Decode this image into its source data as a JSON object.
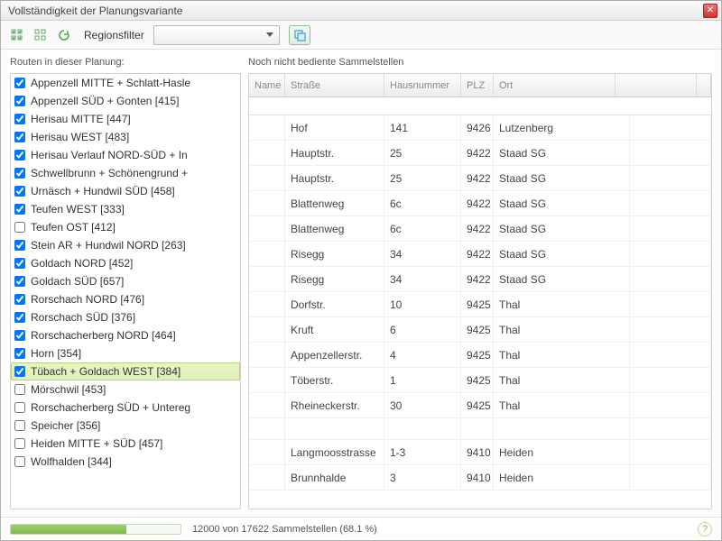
{
  "window": {
    "title": "Vollständigkeit der Planungsvariante"
  },
  "toolbar": {
    "filter_label": "Regionsfilter",
    "filter_value": ""
  },
  "left": {
    "label": "Routen in dieser Planung:",
    "routes": [
      {
        "label": "Appenzell MITTE + Schlatt-Hasle",
        "checked": true,
        "selected": false
      },
      {
        "label": "Appenzell SÜD + Gonten [415]",
        "checked": true,
        "selected": false
      },
      {
        "label": "Herisau MITTE [447]",
        "checked": true,
        "selected": false
      },
      {
        "label": "Herisau WEST [483]",
        "checked": true,
        "selected": false
      },
      {
        "label": "Herisau Verlauf NORD-SÜD + In",
        "checked": true,
        "selected": false
      },
      {
        "label": "Schwellbrunn + Schönengrund +",
        "checked": true,
        "selected": false
      },
      {
        "label": "Urnäsch + Hundwil SÜD [458]",
        "checked": true,
        "selected": false
      },
      {
        "label": "Teufen WEST [333]",
        "checked": true,
        "selected": false
      },
      {
        "label": "Teufen OST [412]",
        "checked": false,
        "selected": false
      },
      {
        "label": "Stein AR + Hundwil NORD [263]",
        "checked": true,
        "selected": false
      },
      {
        "label": "Goldach NORD [452]",
        "checked": true,
        "selected": false
      },
      {
        "label": "Goldach SÜD [657]",
        "checked": true,
        "selected": false
      },
      {
        "label": "Rorschach NORD [476]",
        "checked": true,
        "selected": false
      },
      {
        "label": "Rorschach SÜD [376]",
        "checked": true,
        "selected": false
      },
      {
        "label": "Rorschacherberg NORD [464]",
        "checked": true,
        "selected": false
      },
      {
        "label": "Horn [354]",
        "checked": true,
        "selected": false
      },
      {
        "label": "Tübach + Goldach WEST [384]",
        "checked": true,
        "selected": true
      },
      {
        "label": "Mörschwil [453]",
        "checked": false,
        "selected": false
      },
      {
        "label": "Rorschacherberg SÜD + Untereg",
        "checked": false,
        "selected": false
      },
      {
        "label": "Speicher [356]",
        "checked": false,
        "selected": false
      },
      {
        "label": "Heiden MITTE + SÜD [457]",
        "checked": false,
        "selected": false
      },
      {
        "label": "Wolfhalden  [344]",
        "checked": false,
        "selected": false
      }
    ]
  },
  "right": {
    "label": "Noch nicht bediente Sammelstellen",
    "columns": {
      "name": "Name",
      "street": "Straße",
      "number": "Hausnummer",
      "zip": "PLZ",
      "city": "Ort"
    },
    "rows": [
      {
        "name": "",
        "street": "Hof",
        "number": "141",
        "zip": "9426",
        "city": "Lutzenberg"
      },
      {
        "name": "",
        "street": "Hauptstr.",
        "number": "25",
        "zip": "9422",
        "city": "Staad SG"
      },
      {
        "name": "",
        "street": "Hauptstr.",
        "number": "25",
        "zip": "9422",
        "city": "Staad SG"
      },
      {
        "name": "",
        "street": "Blattenweg",
        "number": "6c",
        "zip": "9422",
        "city": "Staad SG"
      },
      {
        "name": "",
        "street": "Blattenweg",
        "number": "6c",
        "zip": "9422",
        "city": "Staad SG"
      },
      {
        "name": "",
        "street": "Risegg",
        "number": "34",
        "zip": "9422",
        "city": "Staad SG"
      },
      {
        "name": "",
        "street": "Risegg",
        "number": "34",
        "zip": "9422",
        "city": "Staad SG"
      },
      {
        "name": "",
        "street": "Dorfstr.",
        "number": "10",
        "zip": "9425",
        "city": "Thal"
      },
      {
        "name": "",
        "street": "Kruft",
        "number": "6",
        "zip": "9425",
        "city": "Thal"
      },
      {
        "name": "",
        "street": "Appenzellerstr.",
        "number": "4",
        "zip": "9425",
        "city": "Thal"
      },
      {
        "name": "",
        "street": "Töberstr.",
        "number": "1",
        "zip": "9425",
        "city": "Thal"
      },
      {
        "name": "",
        "street": "Rheineckerstr.",
        "number": "30",
        "zip": "9425",
        "city": "Thal"
      },
      {
        "blank": true
      },
      {
        "name": "",
        "street": "Langmoosstrasse",
        "number": "1-3",
        "zip": "9410",
        "city": "Heiden"
      },
      {
        "name": "",
        "street": "Brunnhalde",
        "number": "3",
        "zip": "9410",
        "city": "Heiden"
      }
    ]
  },
  "status": {
    "text": "12000 von 17622 Sammelstellen (68.1 %)",
    "percent": 68.1
  }
}
